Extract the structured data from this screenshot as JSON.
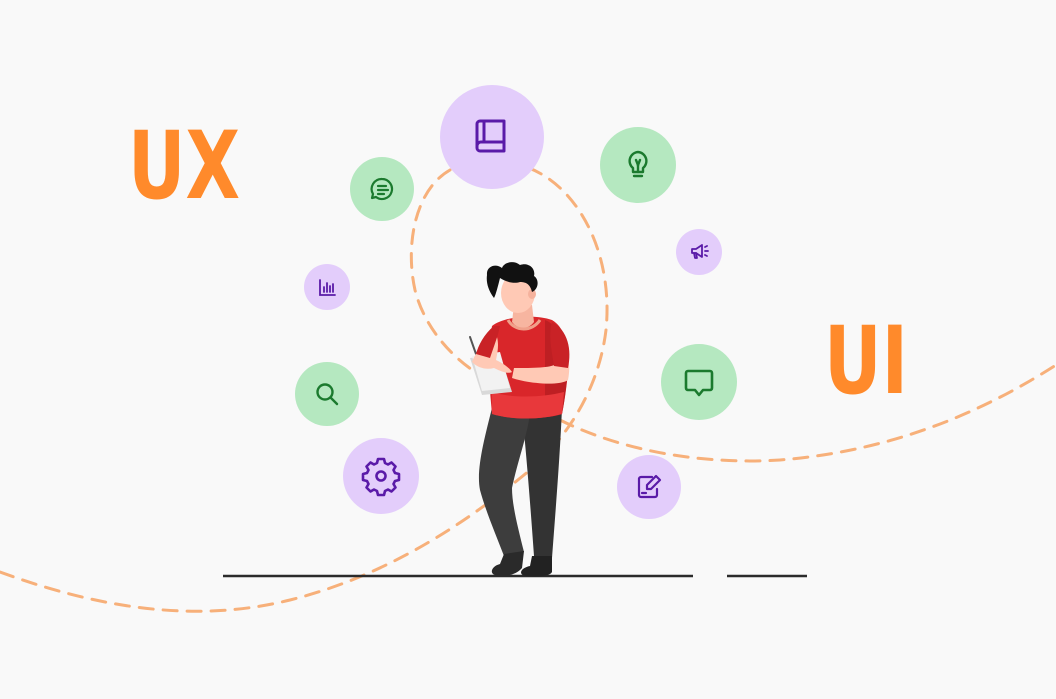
{
  "labels": {
    "ux": "UX",
    "ui": "UI"
  },
  "colors": {
    "background": "#f9f9f9",
    "accent_orange": "#ff8a2b",
    "dash_orange": "#f7b07a",
    "circle_purple": "#e3cdfb",
    "circle_green": "#b5e8c0",
    "icon_purple": "#5a1aa8",
    "icon_green": "#1b7a2e",
    "shirt_red": "#d9262a",
    "pants_dark": "#3c3c3c",
    "skin": "#ffc9b5",
    "hair": "#111111",
    "ground": "#2b2b2b"
  },
  "icons": [
    "book-icon",
    "chat-bubble-icon",
    "lightbulb-icon",
    "megaphone-icon",
    "bar-chart-icon",
    "search-icon",
    "message-icon",
    "settings-gear-icon",
    "edit-note-icon"
  ]
}
